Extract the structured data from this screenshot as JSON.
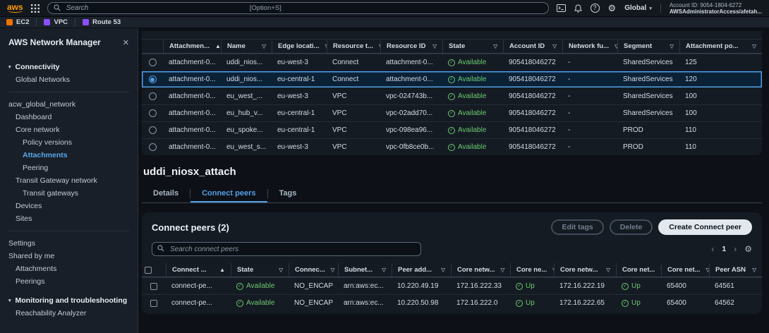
{
  "topbar": {
    "logo_label": "aws",
    "search": {
      "placeholder": "Search",
      "shortcut": "[Option+S]"
    },
    "region": "Global",
    "account_line1": "Account ID: 9054-1804-6272",
    "account_line2": "AWSAdministratorAccess/afetah..."
  },
  "favorites": {
    "items": [
      {
        "label": "EC2",
        "color": "#ed7100"
      },
      {
        "label": "VPC",
        "color": "#8c4fff"
      },
      {
        "label": "Route 53",
        "color": "#8c4fff"
      }
    ]
  },
  "sidebar": {
    "title": "AWS Network Manager",
    "items": [
      {
        "type": "group",
        "label": "Connectivity"
      },
      {
        "type": "link",
        "label": "Global Networks",
        "indent": 1
      },
      {
        "type": "divider"
      },
      {
        "type": "link",
        "label": "acw_global_network",
        "indent": 0
      },
      {
        "type": "link",
        "label": "Dashboard",
        "indent": 1
      },
      {
        "type": "link",
        "label": "Core network",
        "indent": 1
      },
      {
        "type": "link",
        "label": "Policy versions",
        "indent": 2
      },
      {
        "type": "link",
        "label": "Attachments",
        "indent": 2,
        "active": true
      },
      {
        "type": "link",
        "label": "Peering",
        "indent": 2
      },
      {
        "type": "link",
        "label": "Transit Gateway network",
        "indent": 1
      },
      {
        "type": "link",
        "label": "Transit gateways",
        "indent": 2
      },
      {
        "type": "link",
        "label": "Devices",
        "indent": 1
      },
      {
        "type": "link",
        "label": "Sites",
        "indent": 1
      },
      {
        "type": "divider"
      },
      {
        "type": "link",
        "label": "Settings",
        "indent": 0
      },
      {
        "type": "link",
        "label": "Shared by me",
        "indent": 0
      },
      {
        "type": "link",
        "label": "Attachments",
        "indent": 1
      },
      {
        "type": "link",
        "label": "Peerings",
        "indent": 1
      },
      {
        "type": "group",
        "label": "Monitoring and troubleshooting"
      },
      {
        "type": "link",
        "label": "Reachability Analyzer",
        "indent": 1
      }
    ]
  },
  "attachments_table": {
    "selector": "radio",
    "selected_index": 1,
    "columns": [
      {
        "label": "Attachmen...",
        "sort": "asc"
      },
      {
        "label": "Name"
      },
      {
        "label": "Edge locati..."
      },
      {
        "label": "Resource t..."
      },
      {
        "label": "Resource ID"
      },
      {
        "label": "State",
        "type": "status"
      },
      {
        "label": "Account ID"
      },
      {
        "label": "Network fu..."
      },
      {
        "label": "Segment"
      },
      {
        "label": "Attachment po..."
      }
    ],
    "rows": [
      [
        "attachment-0...",
        "uddi_nios...",
        "eu-west-3",
        "Connect",
        "attachment-0...",
        "Available",
        "905418046272",
        "-",
        "SharedServices",
        "125"
      ],
      [
        "attachment-0...",
        "uddi_nios...",
        "eu-central-1",
        "Connect",
        "attachment-0...",
        "Available",
        "905418046272",
        "-",
        "SharedServices",
        "120"
      ],
      [
        "attachment-0...",
        "eu_west_...",
        "eu-west-3",
        "VPC",
        "vpc-024743b...",
        "Available",
        "905418046272",
        "-",
        "SharedServices",
        "100"
      ],
      [
        "attachment-0...",
        "eu_hub_v...",
        "eu-central-1",
        "VPC",
        "vpc-02add70...",
        "Available",
        "905418046272",
        "-",
        "SharedServices",
        "100"
      ],
      [
        "attachment-0...",
        "eu_spoke...",
        "eu-central-1",
        "VPC",
        "vpc-098ea96...",
        "Available",
        "905418046272",
        "-",
        "PROD",
        "110"
      ],
      [
        "attachment-0...",
        "eu_west_s...",
        "eu-west-3",
        "VPC",
        "vpc-0fb8ce0b...",
        "Available",
        "905418046272",
        "-",
        "PROD",
        "110"
      ]
    ]
  },
  "detail": {
    "title": "uddi_niosx_attach",
    "tabs": [
      {
        "label": "Details"
      },
      {
        "label": "Connect peers",
        "active": true
      },
      {
        "label": "Tags"
      }
    ]
  },
  "peers_panel": {
    "title": "Connect peers (2)",
    "actions": [
      {
        "label": "Edit tags",
        "disabled": true
      },
      {
        "label": "Delete",
        "disabled": true
      },
      {
        "label": "Create Connect peer",
        "primary": true
      }
    ],
    "search_placeholder": "Search connect peers",
    "pagination": {
      "page": "1"
    },
    "table": {
      "selector": "checkbox",
      "columns": [
        {
          "label": "Connect ...",
          "sort": "asc"
        },
        {
          "label": "State",
          "type": "status"
        },
        {
          "label": "Connec..."
        },
        {
          "label": "Subnet..."
        },
        {
          "label": "Peer add..."
        },
        {
          "label": "Core netw..."
        },
        {
          "label": "Core ne...",
          "type": "status"
        },
        {
          "label": "Core netw..."
        },
        {
          "label": "Core net...",
          "type": "status"
        },
        {
          "label": "Core net..."
        },
        {
          "label": "Peer ASN"
        }
      ],
      "rows": [
        [
          "connect-pe...",
          "Available",
          "NO_ENCAP",
          "arn:aws:ec...",
          "10.220.49.19",
          "172.16.222.33",
          "Up",
          "172.16.222.19",
          "Up",
          "65400",
          "64561"
        ],
        [
          "connect-pe...",
          "Available",
          "NO_ENCAP",
          "arn:aws:ec...",
          "10.220.50.98",
          "172.16.222.0",
          "Up",
          "172.16.222.65",
          "Up",
          "65400",
          "64562"
        ]
      ]
    }
  },
  "colors": {
    "accent_blue": "#539fe5",
    "success_green": "#6cc970",
    "aws_orange": "#ff9900"
  }
}
